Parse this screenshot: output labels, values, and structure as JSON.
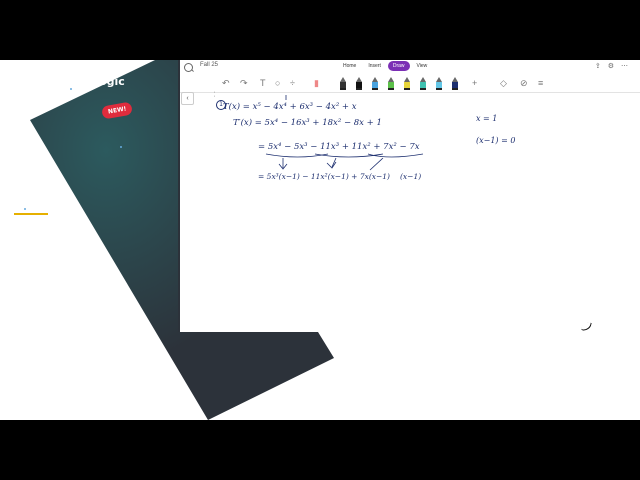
{
  "app": {
    "doc_title": "Fall 25",
    "tabs": [
      {
        "label": "Home",
        "active": false
      },
      {
        "label": "Insert",
        "active": false
      },
      {
        "label": "Draw",
        "active": true
      },
      {
        "label": "View",
        "active": false
      }
    ],
    "accent_color": "#7b2fb5"
  },
  "promo": {
    "brand": "Logic",
    "badge": "NEW!",
    "badge_color": "#e02c3d",
    "accent_line_color": "#e6b000"
  },
  "notes": {
    "problem_number": "1",
    "line1": "T(x) = x⁵ − 4x⁴ + 6x³ − 4x² + x",
    "line2": "T′(x) = 5x⁴ − 16x³ + 18x² − 8x + 1",
    "line3": "= 5x⁴ − 5x³ − 11x³ + 11x² + 7x² − 7x",
    "line4": "= 5x³(x−1) − 11x²(x−1) + 7x(x−1)",
    "line4b": "(x−1)",
    "right1": "x = 1",
    "right2": "(x−1) = 0"
  }
}
